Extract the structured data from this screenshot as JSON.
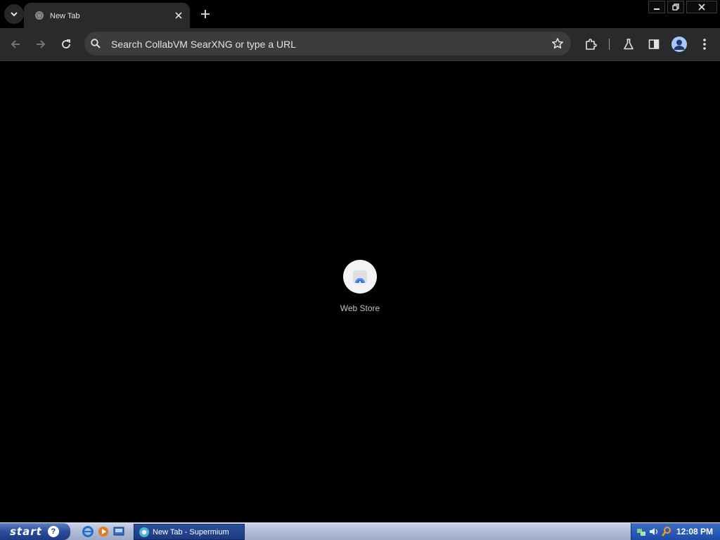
{
  "browser": {
    "tab": {
      "title": "New Tab"
    },
    "omnibox": {
      "placeholder": "Search CollabVM SearXNG or type a URL"
    }
  },
  "content": {
    "shortcut": {
      "label": "Web Store",
      "icon": "webstore-icon"
    }
  },
  "taskbar": {
    "start_label": "start",
    "task_button_label": "New Tab - Supermium",
    "clock": "12:08 PM"
  },
  "colors": {
    "page_background": "#000000",
    "toolbar": "#282a2c",
    "omnibox": "#3c3c3c",
    "taskbar": "#b4c0d9",
    "start": "#2c4d9a",
    "tray": "#1c4ba8"
  }
}
